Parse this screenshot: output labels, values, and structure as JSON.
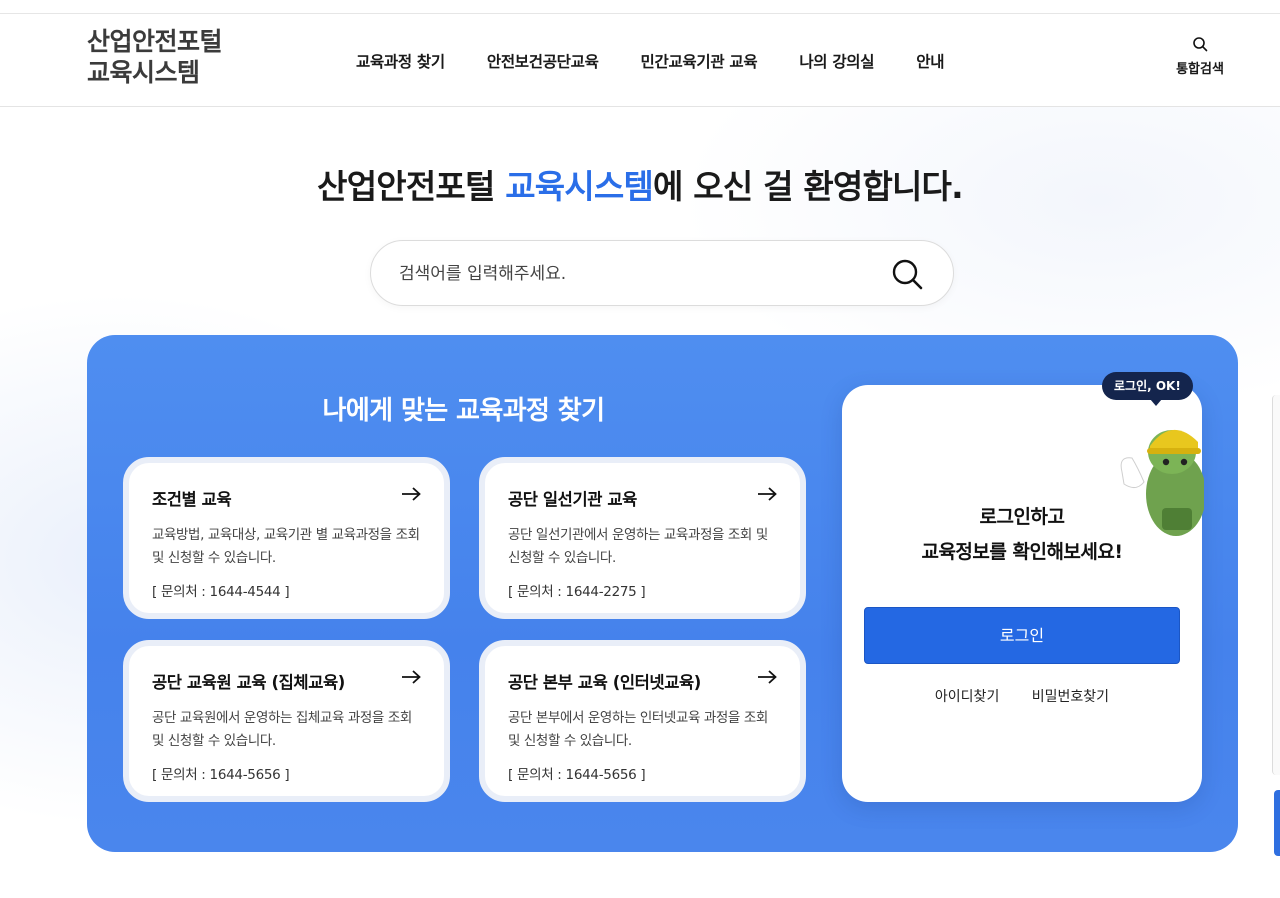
{
  "header": {
    "logo_line1": "산업안전포털",
    "logo_line2": "교육시스템",
    "nav": [
      {
        "label": "교육과정 찾기"
      },
      {
        "label": "안전보건공단교육"
      },
      {
        "label": "민간교육기관 교육"
      },
      {
        "label": "나의 강의실"
      },
      {
        "label": "안내"
      }
    ],
    "total_search_label": "통합검색",
    "total_search_icon": "search-icon"
  },
  "welcome": {
    "prefix": "산업안전포털 ",
    "highlight": "교육시스템",
    "suffix": "에 오신 걸 환영합니다.",
    "highlight_color": "#2a6ee8"
  },
  "search": {
    "placeholder": "검색어를 입력해주세요.",
    "value": "",
    "icon": "search-icon"
  },
  "finder": {
    "title": "나에게 맞는 교육과정 찾기",
    "panel_color": "#4a86ed",
    "cards": [
      {
        "title": "조건별 교육",
        "desc": "교육방법, 교육대상, 교육기관 별 교육과정을 조회및 신청할 수 있습니다.",
        "contact": "[ 문의처 : 1644-4544 ]",
        "icon": "arrow-right-icon"
      },
      {
        "title": "공단 일선기관 교육",
        "desc": "공단 일선기관에서 운영하는 교육과정을 조회 및 신청할 수 있습니다.",
        "contact": "[ 문의처 : 1644-2275 ]",
        "icon": "arrow-right-icon"
      },
      {
        "title": "공단 교육원 교육 (집체교육)",
        "desc": "공단 교육원에서 운영하는 집체교육 과정을 조회 및 신청할 수 있습니다.",
        "contact": "[ 문의처 : 1644-5656 ]",
        "icon": "arrow-right-icon"
      },
      {
        "title": "공단 본부 교육 (인터넷교육)",
        "desc": "공단 본부에서 운영하는 인터넷교육 과정을 조회 및 신청할 수 있습니다.",
        "contact": "[ 문의처 : 1644-5656 ]",
        "icon": "arrow-right-icon"
      }
    ]
  },
  "login": {
    "badge": "로그인, OK!",
    "message_line1": "로그인하고",
    "message_line2": "교육정보를 확인해보세요!",
    "button_label": "로그인",
    "button_color": "#2468e3",
    "find_id": "아이디찾기",
    "find_password": "비밀번호찾기",
    "mascot_icon": "mascot-icon"
  }
}
